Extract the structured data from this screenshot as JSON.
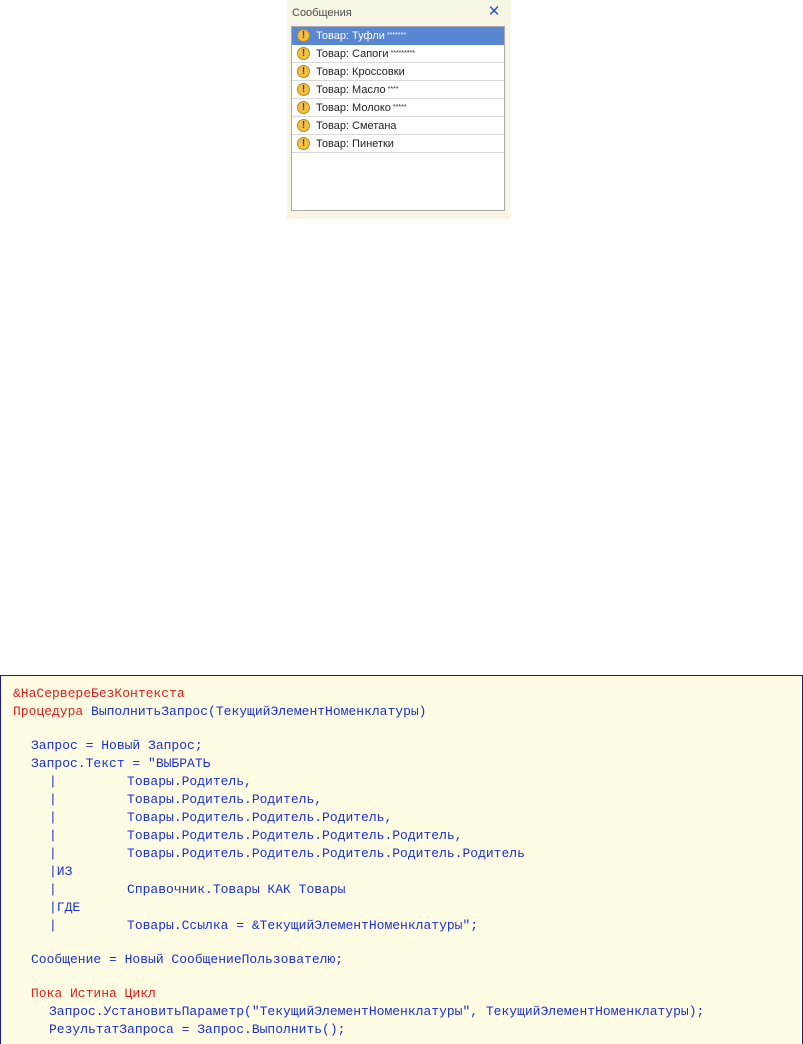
{
  "messages_panel": {
    "title": "Сообщения",
    "items": [
      {
        "text": "Товар: Туфли",
        "suffix": "*******"
      },
      {
        "text": "Товар: Сапоги",
        "suffix": "*********"
      },
      {
        "text": "Товар: Кроссовки",
        "suffix": ""
      },
      {
        "text": "Товар: Масло",
        "suffix": "****"
      },
      {
        "text": "Товар: Молоко",
        "suffix": "*****"
      },
      {
        "text": "Товар: Сметана",
        "suffix": ""
      },
      {
        "text": "Товар: Пинетки",
        "suffix": ""
      }
    ]
  },
  "code": {
    "line1": "&НаСервереБезКонтекста",
    "line2_kw": "Процедура",
    "line2_rest": " ВыполнитьЗапрос(ТекущийЭлементНоменклатуры)",
    "line3": "Запрос = Новый Запрос;",
    "line4": "Запрос.Текст = \"ВЫБРАТЬ",
    "line5": "|         Товары.Родитель,",
    "line6": "|         Товары.Родитель.Родитель,",
    "line7": "|         Товары.Родитель.Родитель.Родитель,",
    "line8": "|         Товары.Родитель.Родитель.Родитель.Родитель,",
    "line9": "|         Товары.Родитель.Родитель.Родитель.Родитель.Родитель",
    "line10": "|ИЗ",
    "line11": "|         Справочник.Товары КАК Товары",
    "line12": "|ГДЕ",
    "line13": "|         Товары.Ссылка = &ТекущийЭлементНоменклатуры\";",
    "line14": "Сообщение = Новый СообщениеПользователю;",
    "line15": "Пока Истина Цикл",
    "line16": "Запрос.УстановитьПараметр(\"ТекущийЭлементНоменклатуры\", ТекущийЭлементНоменклатуры);",
    "line17": "РезультатЗапроса = Запрос.Выполнить();"
  },
  "colors": {
    "selection": "#5a87d4",
    "code_background": "#fefde3",
    "keyword": "#e11d1d",
    "identifier": "#1b2fd4"
  }
}
